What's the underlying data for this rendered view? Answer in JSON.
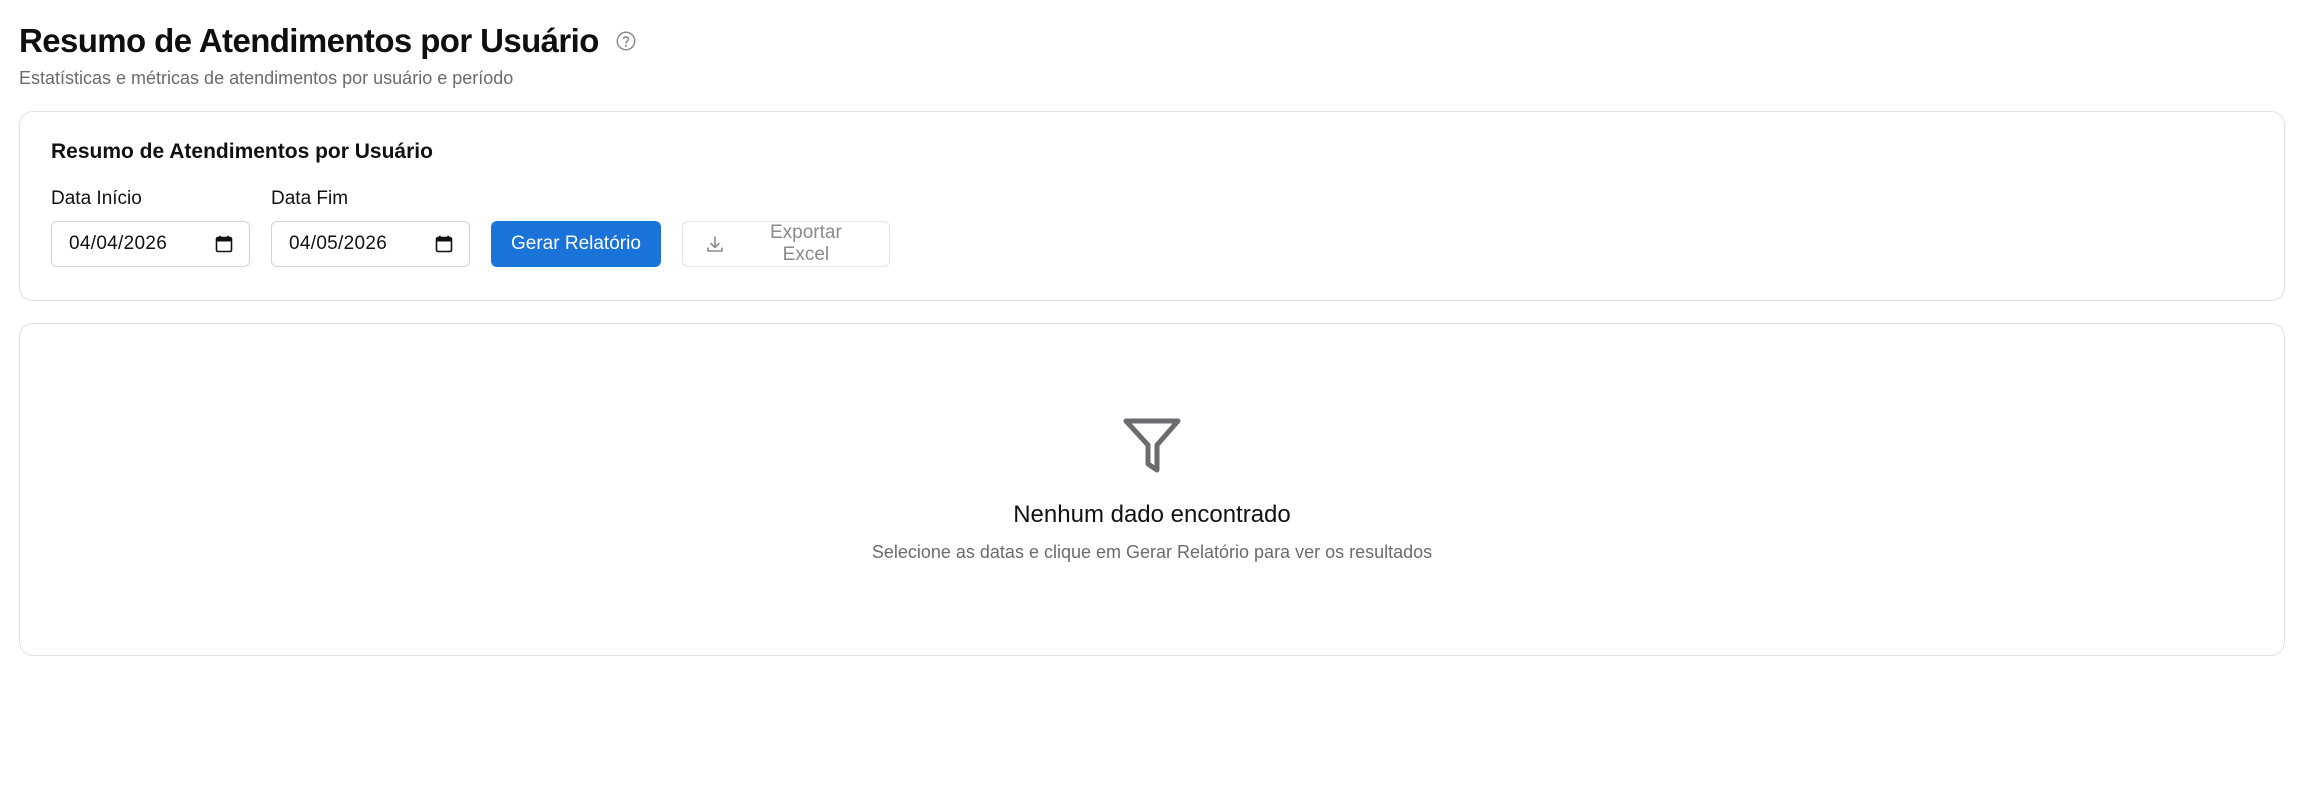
{
  "page": {
    "title": "Resumo de Atendimentos por Usuário",
    "subtitle": "Estatísticas e métricas de atendimentos por usuário e período",
    "help_icon": "question-circle-icon"
  },
  "filters": {
    "card_title": "Resumo de Atendimentos por Usuário",
    "start_date_label": "Data Início",
    "start_date_value": "04/04/2026",
    "end_date_label": "Data Fim",
    "end_date_value": "04/05/2026",
    "calendar_icon": "calendar-icon",
    "generate_label": "Gerar Relatório",
    "export_label": "Exportar Excel",
    "export_icon": "download-icon"
  },
  "empty_state": {
    "icon": "filter-icon",
    "title": "Nenhum dado encontrado",
    "message": "Selecione as datas e clique em Gerar Relatório para ver os resultados"
  },
  "colors": {
    "primary": "#1a73d9",
    "border": "#e1e1e4",
    "muted_text": "#6b6b6b",
    "icon_gray": "#6b6b70"
  }
}
